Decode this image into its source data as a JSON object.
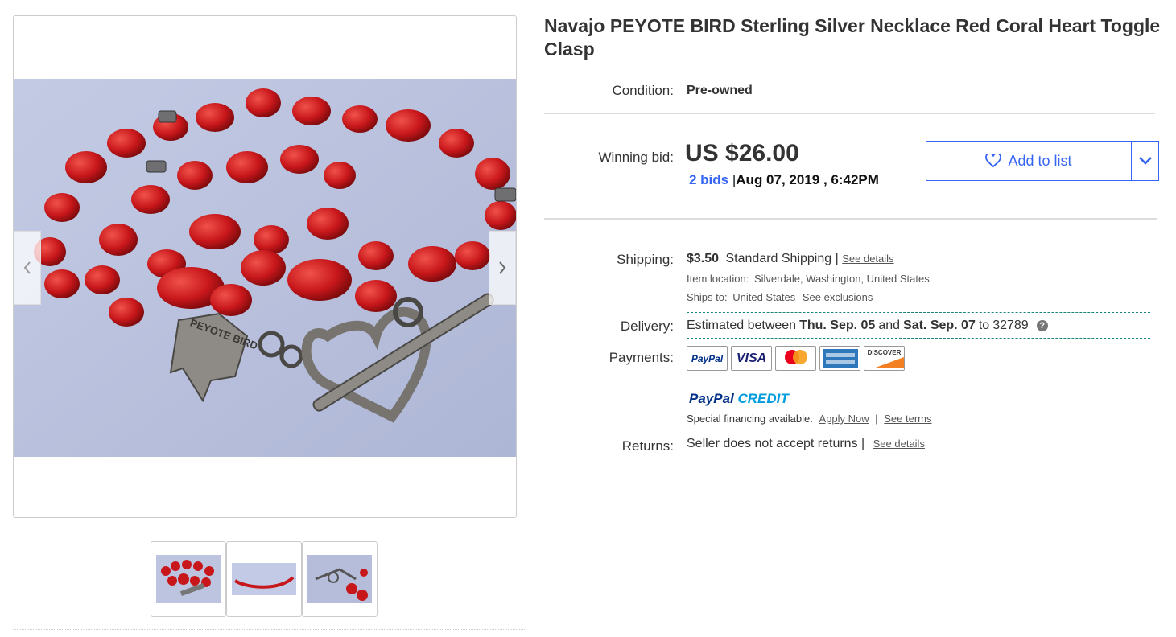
{
  "listing": {
    "title": "Navajo PEYOTE BIRD Sterling Silver Necklace Red Coral Heart Toggle Clasp",
    "condition_label": "Condition:",
    "condition_value": "Pre-owned",
    "winning_bid_label": "Winning bid:",
    "price": "US $26.00",
    "bid_count": "2 bids",
    "bid_sep": "|",
    "end_date": "Aug 07, 2019 , 6:42PM",
    "add_to_list": "Add to list"
  },
  "shipping": {
    "label": "Shipping:",
    "cost": "$3.50",
    "method": "Standard Shipping",
    "sep": "|",
    "details_link": "See details",
    "location_label": "Item location:",
    "location_value": "Silverdale, Washington, United States",
    "ships_to_label": "Ships to:",
    "ships_to_value": "United States",
    "exclusions_link": "See exclusions"
  },
  "delivery": {
    "label": "Delivery:",
    "prefix": "Estimated between",
    "start": "Thu. Sep. 05",
    "and": "and",
    "end": "Sat. Sep. 07",
    "to": "to",
    "zip": "32789"
  },
  "payments": {
    "label": "Payments:",
    "cards": [
      "paypal",
      "visa",
      "mastercard",
      "amex",
      "discover"
    ],
    "paypal_card_text": "PayPal",
    "visa_card_text": "VISA",
    "discover_card_text": "DISCOVER",
    "paypal_credit_pay": "PayPal",
    "paypal_credit_word": "CREDIT",
    "financing": "Special financing available.",
    "apply_link": "Apply Now",
    "sep": "|",
    "terms_link": "See terms"
  },
  "returns": {
    "label": "Returns:",
    "value": "Seller does not accept returns",
    "sep": "|",
    "details_link": "See details"
  },
  "gallery": {
    "thumbnail_count": 3,
    "peyote_stamp": "PEYOTE BIRD"
  },
  "colors": {
    "accent": "#3665f3",
    "coral": "#c8171b",
    "teal_dash": "#178678"
  }
}
